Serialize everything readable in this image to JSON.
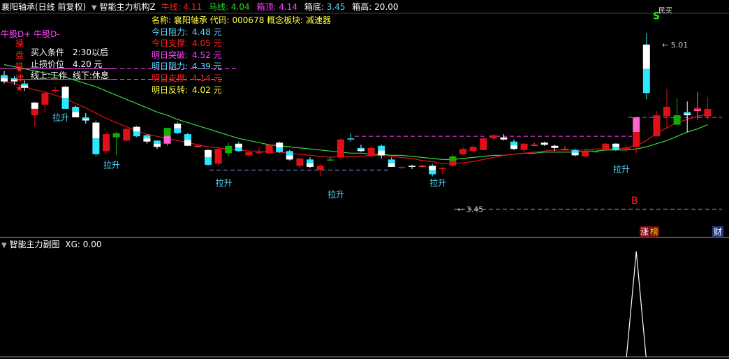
{
  "colors": {
    "up_box": "#e0101a",
    "down_box": "#2ee6ff",
    "white": "#ffffff",
    "green": "#0fb000",
    "pink": "#ff66cc",
    "red_line": "#e0101a",
    "green_line": "#3ad63a",
    "yellow": "#ffff00",
    "cyan_text": "#57d9ff",
    "magenta": "#ff40ff"
  },
  "header": {
    "stock_title": "襄阳轴承(日线 前复权)",
    "indicator_name": "智能主力机构Z",
    "niu_label": "牛线:",
    "niu_value": "4.11",
    "ma_label": "马线:",
    "ma_value": "4.04",
    "box_top_label": "箱顶:",
    "box_top_value": "4.14",
    "box_bottom_label": "箱底:",
    "box_bottom_value": "3.45",
    "box_high_label": "箱高:",
    "box_high_value": "20.00"
  },
  "info": {
    "name_row": "名称: 襄阳轴承 代码: 000678  概念板块: 减速器",
    "rows": [
      {
        "label": "今日阻力:",
        "value": "4.48 元",
        "color": "#57d9ff"
      },
      {
        "label": "今日支撑:",
        "value": "4.05 元",
        "color": "#ff2020"
      },
      {
        "label": "明日突破:",
        "value": "4.52 元",
        "color": "#ff40ff"
      },
      {
        "label": "明日阻力:",
        "value": "4.39 元",
        "color": "#57d9ff"
      },
      {
        "label": "明日支撑:",
        "value": "4.14 元",
        "color": "#ff2020"
      },
      {
        "label": "明日反转:",
        "value": "4.02 元",
        "color": "#ffff40"
      }
    ]
  },
  "left_panel": {
    "legend_plus": "牛股D+",
    "legend_minus": "牛股D-",
    "vertical_chars": [
      "操",
      "盘",
      "铁",
      "律"
    ],
    "rules": [
      {
        "label": "买入条件",
        "value": "2:30以后"
      },
      {
        "label": "止损价位",
        "value": "4.20 元"
      },
      {
        "label": "线上:工作",
        "value": "线下:休息"
      }
    ]
  },
  "chart_data": {
    "type": "candlestick",
    "price_ylim": [
      3.3,
      5.3
    ],
    "candles": [
      {
        "o": 4.72,
        "h": 4.76,
        "l": 4.64,
        "c": 4.66,
        "s": "white"
      },
      {
        "o": 4.69,
        "h": 4.71,
        "l": 4.63,
        "c": 4.66,
        "s": "white"
      },
      {
        "o": 4.64,
        "h": 4.67,
        "l": 4.57,
        "c": 4.6,
        "s": "white"
      },
      {
        "o": 4.34,
        "h": 4.47,
        "l": 4.23,
        "c": 4.46,
        "s": "redwhite"
      },
      {
        "o": 4.44,
        "h": 4.56,
        "l": 4.36,
        "c": 4.55,
        "s": "up"
      },
      {
        "o": 4.57,
        "h": 4.61,
        "l": 4.55,
        "c": 4.58,
        "s": "up"
      },
      {
        "o": 4.61,
        "h": 4.62,
        "l": 4.4,
        "c": 4.4,
        "s": "down"
      },
      {
        "o": 4.42,
        "h": 4.43,
        "l": 4.32,
        "c": 4.32,
        "s": "white"
      },
      {
        "o": 4.32,
        "h": 4.36,
        "l": 4.26,
        "c": 4.29,
        "s": "white"
      },
      {
        "o": 4.27,
        "h": 4.29,
        "l": 3.95,
        "c": 3.97,
        "s": "down"
      },
      {
        "o": 4.0,
        "h": 4.18,
        "l": 3.98,
        "c": 4.16,
        "s": "up"
      },
      {
        "o": 4.13,
        "h": 4.18,
        "l": 3.96,
        "c": 4.17,
        "s": "green"
      },
      {
        "o": 4.1,
        "h": 4.22,
        "l": 4.09,
        "c": 4.21,
        "s": "up"
      },
      {
        "o": 4.23,
        "h": 4.24,
        "l": 4.13,
        "c": 4.14,
        "s": "down"
      },
      {
        "o": 4.15,
        "h": 4.16,
        "l": 4.07,
        "c": 4.09,
        "s": "white"
      },
      {
        "o": 4.1,
        "h": 4.1,
        "l": 4.02,
        "c": 4.04,
        "s": "white"
      },
      {
        "o": 4.07,
        "h": 4.22,
        "l": 4.05,
        "c": 4.22,
        "s": "pinkgreen"
      },
      {
        "o": 4.26,
        "h": 4.28,
        "l": 4.16,
        "c": 4.17,
        "s": "down"
      },
      {
        "o": 4.16,
        "h": 4.17,
        "l": 4.05,
        "c": 4.05,
        "s": "white"
      },
      {
        "o": 4.04,
        "h": 4.06,
        "l": 4.03,
        "c": 4.05,
        "s": "cross"
      },
      {
        "o": 4.01,
        "h": 4.02,
        "l": 3.86,
        "c": 3.87,
        "s": "down"
      },
      {
        "o": 3.88,
        "h": 4.04,
        "l": 3.86,
        "c": 4.02,
        "s": "up"
      },
      {
        "o": 3.98,
        "h": 4.08,
        "l": 3.95,
        "c": 4.05,
        "s": "green"
      },
      {
        "o": 4.07,
        "h": 4.09,
        "l": 3.99,
        "c": 4.0,
        "s": "down"
      },
      {
        "o": 3.96,
        "h": 4.01,
        "l": 3.94,
        "c": 3.99,
        "s": "up"
      },
      {
        "o": 3.99,
        "h": 4.03,
        "l": 3.97,
        "c": 3.98,
        "s": "up"
      },
      {
        "o": 3.98,
        "h": 4.06,
        "l": 3.98,
        "c": 4.06,
        "s": "up"
      },
      {
        "o": 4.08,
        "h": 4.09,
        "l": 3.98,
        "c": 3.99,
        "s": "down"
      },
      {
        "o": 4.0,
        "h": 4.01,
        "l": 3.91,
        "c": 3.92,
        "s": "white"
      },
      {
        "o": 3.86,
        "h": 3.93,
        "l": 3.84,
        "c": 3.93,
        "s": "up"
      },
      {
        "o": 3.92,
        "h": 3.94,
        "l": 3.84,
        "c": 3.85,
        "s": "white"
      },
      {
        "o": 3.86,
        "h": 3.88,
        "l": 3.76,
        "c": 3.82,
        "s": "up"
      },
      {
        "o": 3.92,
        "h": 3.94,
        "l": 3.91,
        "c": 3.92,
        "s": "greencross"
      },
      {
        "o": 3.94,
        "h": 4.12,
        "l": 3.92,
        "c": 4.11,
        "s": "up"
      },
      {
        "o": 4.12,
        "h": 4.17,
        "l": 4.09,
        "c": 4.12,
        "s": "down"
      },
      {
        "o": 4.03,
        "h": 4.06,
        "l": 3.99,
        "c": 4.0,
        "s": "white"
      },
      {
        "o": 3.95,
        "h": 4.05,
        "l": 3.94,
        "c": 4.03,
        "s": "up"
      },
      {
        "o": 4.05,
        "h": 4.06,
        "l": 3.93,
        "c": 3.96,
        "s": "white"
      },
      {
        "o": 3.92,
        "h": 3.94,
        "l": 3.85,
        "c": 3.85,
        "s": "white"
      },
      {
        "o": 3.84,
        "h": 3.86,
        "l": 3.83,
        "c": 3.85,
        "s": "up"
      },
      {
        "o": 3.86,
        "h": 3.87,
        "l": 3.83,
        "c": 3.85,
        "s": "white"
      },
      {
        "o": 3.86,
        "h": 3.87,
        "l": 3.84,
        "c": 3.86,
        "s": "cross"
      },
      {
        "o": 3.86,
        "h": 3.88,
        "l": 3.76,
        "c": 3.78,
        "s": "down"
      },
      {
        "o": 3.83,
        "h": 3.85,
        "l": 3.78,
        "c": 3.84,
        "s": "up"
      },
      {
        "o": 3.86,
        "h": 3.97,
        "l": 3.85,
        "c": 3.95,
        "s": "redgreen"
      },
      {
        "o": 3.97,
        "h": 4.04,
        "l": 3.96,
        "c": 4.02,
        "s": "up"
      },
      {
        "o": 4.0,
        "h": 4.06,
        "l": 3.99,
        "c": 4.04,
        "s": "up"
      },
      {
        "o": 4.01,
        "h": 4.13,
        "l": 4.01,
        "c": 4.12,
        "s": "up"
      },
      {
        "o": 4.15,
        "h": 4.16,
        "l": 4.1,
        "c": 4.12,
        "s": "up"
      },
      {
        "o": 4.13,
        "h": 4.16,
        "l": 4.1,
        "c": 4.11,
        "s": "white"
      },
      {
        "o": 4.09,
        "h": 4.11,
        "l": 4.01,
        "c": 4.02,
        "s": "white"
      },
      {
        "o": 4.01,
        "h": 4.08,
        "l": 3.99,
        "c": 4.07,
        "s": "up"
      },
      {
        "o": 4.06,
        "h": 4.08,
        "l": 4.05,
        "c": 4.06,
        "s": "cross"
      },
      {
        "o": 4.08,
        "h": 4.09,
        "l": 4.05,
        "c": 4.06,
        "s": "white"
      },
      {
        "o": 4.05,
        "h": 4.06,
        "l": 4.0,
        "c": 4.03,
        "s": "white"
      },
      {
        "o": 4.02,
        "h": 4.05,
        "l": 4.01,
        "c": 4.02,
        "s": "cross"
      },
      {
        "o": 4.01,
        "h": 4.02,
        "l": 3.95,
        "c": 3.96,
        "s": "white"
      },
      {
        "o": 3.95,
        "h": 4.02,
        "l": 3.94,
        "c": 4.0,
        "s": "up"
      },
      {
        "o": 4.0,
        "h": 4.0,
        "l": 3.98,
        "c": 3.99,
        "s": "greencross"
      },
      {
        "o": 4.01,
        "h": 4.08,
        "l": 4.0,
        "c": 4.07,
        "s": "up"
      },
      {
        "o": 4.07,
        "h": 4.08,
        "l": 4.0,
        "c": 4.01,
        "s": "down"
      },
      {
        "o": 4.03,
        "h": 4.06,
        "l": 3.99,
        "c": 4.02,
        "s": "up"
      },
      {
        "o": 4.04,
        "h": 4.32,
        "l": 3.98,
        "c": 4.32,
        "s": "redpink"
      },
      {
        "o": 4.55,
        "h": 5.12,
        "l": 4.49,
        "c": 5.01,
        "s": "down"
      },
      {
        "o": 4.14,
        "h": 4.38,
        "l": 4.14,
        "c": 4.34,
        "s": "up"
      },
      {
        "o": 4.33,
        "h": 4.59,
        "l": 4.21,
        "c": 4.42,
        "s": "up"
      },
      {
        "o": 4.34,
        "h": 4.5,
        "l": 4.26,
        "c": 4.25,
        "s": "green"
      },
      {
        "o": 4.34,
        "h": 4.47,
        "l": 4.18,
        "c": 4.37,
        "s": "white"
      },
      {
        "o": 4.38,
        "h": 4.56,
        "l": 4.3,
        "c": 4.41,
        "s": "pinkred"
      },
      {
        "o": 4.4,
        "h": 4.51,
        "l": 4.3,
        "c": 4.33,
        "s": "up"
      }
    ],
    "ma_red": [
      4.66,
      4.64,
      4.61,
      4.58,
      4.56,
      4.53,
      4.5,
      4.45,
      4.41,
      4.36,
      4.31,
      4.27,
      4.23,
      4.19,
      4.16,
      4.14,
      4.12,
      4.1,
      4.08,
      4.06,
      4.04,
      4.03,
      4.02,
      4.01,
      4.0,
      4.0,
      3.99,
      3.99,
      3.98,
      3.97,
      3.96,
      3.95,
      3.94,
      3.95,
      3.95,
      3.95,
      3.96,
      3.96,
      3.95,
      3.94,
      3.93,
      3.91,
      3.9,
      3.88,
      3.88,
      3.89,
      3.9,
      3.92,
      3.94,
      3.96,
      3.97,
      3.98,
      3.99,
      4.0,
      4.01,
      4.01,
      4.01,
      4.01,
      4.02,
      4.02,
      4.02,
      4.03,
      4.05,
      4.1,
      4.17,
      4.22,
      4.27,
      4.3,
      4.33,
      4.35
    ],
    "ma_green": [
      4.82,
      4.8,
      4.78,
      4.76,
      4.74,
      4.72,
      4.7,
      4.67,
      4.64,
      4.61,
      4.57,
      4.53,
      4.49,
      4.45,
      4.41,
      4.37,
      4.34,
      4.3,
      4.27,
      4.24,
      4.21,
      4.18,
      4.15,
      4.12,
      4.1,
      4.08,
      4.06,
      4.05,
      4.04,
      4.03,
      4.02,
      4.01,
      4.0,
      3.99,
      3.98,
      3.98,
      3.97,
      3.97,
      3.96,
      3.96,
      3.95,
      3.94,
      3.93,
      3.92,
      3.92,
      3.93,
      3.94,
      3.95,
      3.96,
      3.96,
      3.97,
      3.98,
      3.98,
      3.99,
      3.99,
      3.99,
      3.99,
      4.0,
      4.0,
      4.01,
      4.01,
      4.01,
      4.02,
      4.04,
      4.07,
      4.1,
      4.14,
      4.18,
      4.21,
      4.25
    ],
    "box_levels": {
      "top": 4.14,
      "bottom": 3.45,
      "upper": 4.78,
      "upper_dash": 4.68,
      "recent_top": 4.32
    },
    "annotations": [
      {
        "text": "拉升",
        "i": 5,
        "price": 4.29
      },
      {
        "text": "拉升",
        "i": 10,
        "price": 3.84
      },
      {
        "text": "拉升",
        "i": 21,
        "price": 3.67
      },
      {
        "text": "拉升",
        "i": 32,
        "price": 3.56
      },
      {
        "text": "拉升",
        "i": 42,
        "price": 3.67
      },
      {
        "text": "拉升",
        "i": 60,
        "price": 3.8
      }
    ],
    "labels": {
      "box_bottom_label": "3.45",
      "peak_label": "5.01",
      "b_mark": "B",
      "s_mark": "S",
      "sell_text": "民买"
    },
    "sub_xg": {
      "peak_index": 62,
      "value": 0.0
    }
  },
  "bottom_badges": {
    "zhang": "涨",
    "bang": "榜",
    "cai": "财"
  },
  "sub_header": {
    "title": "智能主力副图",
    "xg_label": "XG:",
    "xg_value": "0.00"
  }
}
